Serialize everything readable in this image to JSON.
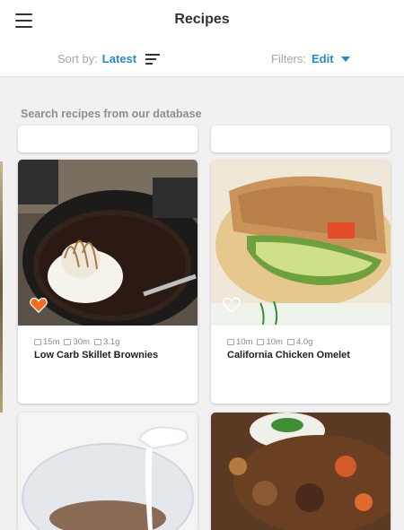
{
  "header": {
    "title": "Recipes",
    "menu_icon": "hamburger-menu-icon"
  },
  "toolbar": {
    "sort_label": "Sort by:",
    "sort_value": "Latest",
    "sort_icon": "sort-lines-icon",
    "filters_label": "Filters:",
    "filters_value": "Edit",
    "filters_icon": "caret-down-icon"
  },
  "search": {
    "placeholder": "Search recipes from our database"
  },
  "colors": {
    "accent": "#2a88c6",
    "favorite": "#f36c21"
  },
  "recipes": [
    {
      "name": "Low Carb Skillet Brownies",
      "prep": "15m",
      "cook": "30m",
      "carbs": "3.1g",
      "favorited": true
    },
    {
      "name": "California Chicken Omelet",
      "prep": "10m",
      "cook": "10m",
      "carbs": "4.0g",
      "favorited": false
    }
  ]
}
